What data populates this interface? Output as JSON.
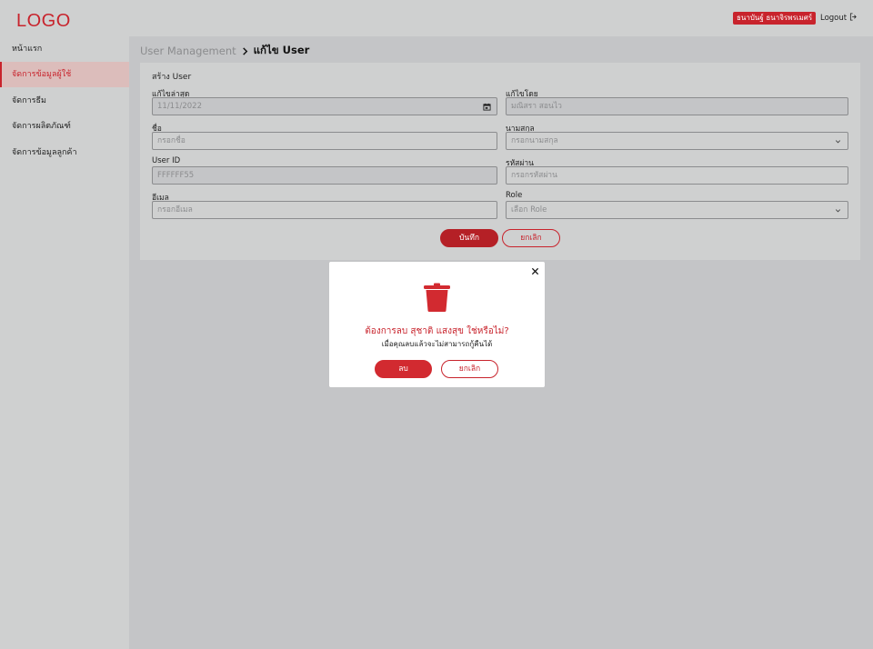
{
  "header": {
    "logo": "LOGO",
    "user_name": "ธนาบันฐ์ ธนาจิรพรเมศร์",
    "logout_label": "Logout"
  },
  "sidebar": {
    "items": [
      {
        "label": "หน้าแรก",
        "active": false
      },
      {
        "label": "จัดการข้อมูลผู้ใช้",
        "active": true
      },
      {
        "label": "จัดการธีม",
        "active": false
      },
      {
        "label": "จัดการผลิตภัณฑ์",
        "active": false
      },
      {
        "label": "จัดการข้อมูลลูกค้า",
        "active": false
      }
    ]
  },
  "breadcrumb": {
    "parent": "User Management",
    "current": "แก้ไข User"
  },
  "form": {
    "title": "สร้าง User",
    "last_edited_label": "แก้ไขล่าสุด",
    "last_edited_value": "11/11/2022",
    "edited_by_label": "แก้ไขโดย",
    "edited_by_value": "มณิสรา สอนไว",
    "first_name_label": "ชื่อ",
    "first_name_placeholder": "กรอกชื่อ",
    "last_name_label": "นามสกุล",
    "last_name_placeholder": "กรอกนามสกุล",
    "user_id_label": "User ID",
    "user_id_value": "FFFFFF55",
    "password_label": "รหัสผ่าน",
    "password_placeholder": "กรอกรหัสผ่าน",
    "email_label": "อีเมล",
    "email_placeholder": "กรอกอีเมล",
    "role_label": "Role",
    "role_placeholder": "เลือก Role",
    "save_label": "บันทึก",
    "cancel_label": "ยกเลิก"
  },
  "modal": {
    "title": "ต้องการลบ สุชาติ แสงสุข ใช่หรือไม่?",
    "subtitle": "เมื่อคุณลบแล้วจะไม่สามารถกู้คืนได้",
    "confirm_label": "ลบ",
    "cancel_label": "ยกเลิก"
  },
  "colors": {
    "brand": "#c8232c",
    "sidebar_active_bg": "#dcbdbb",
    "overlay": "#c4c5c7"
  },
  "icons": [
    "calendar-icon",
    "chevron-down-icon",
    "logout-icon",
    "close-icon",
    "trash-icon",
    "chevron-right-icon"
  ]
}
